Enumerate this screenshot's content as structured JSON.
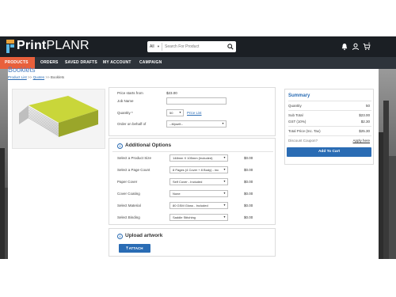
{
  "header": {
    "logo_left": "Print",
    "logo_right": "PLANR",
    "search": {
      "scope": "All",
      "placeholder": "Search For Product"
    },
    "icons": [
      "bell-icon",
      "user-icon",
      "cart-icon"
    ],
    "cart_count": "0"
  },
  "nav": [
    {
      "label": "PRODUCTS",
      "active": true
    },
    {
      "label": "ORDERS",
      "active": false
    },
    {
      "label": "SAVED DRAFTS",
      "active": false
    },
    {
      "label": "MY ACCOUNT",
      "active": false
    },
    {
      "label": "CAMPAIGN",
      "active": false
    }
  ],
  "page": {
    "title": "Booklets",
    "breadcrumb": [
      "Product List",
      "Quotes",
      "Booklets"
    ],
    "breadcrumb_sep": ">>"
  },
  "details": {
    "price_label": "Price starts from",
    "price_value": "$23.00",
    "job_name_label": "Job Name",
    "job_name_value": "",
    "quantity_label": "Quantity *",
    "quantity_value": "50",
    "price_list_link": "Price List",
    "on_behalf_label": "Order on behalf of",
    "on_behalf_value": "--Myself--"
  },
  "options": {
    "title": "Additional Options",
    "rows": [
      {
        "label": "Select a Product Size",
        "value": "148mm X 105mm (Included)",
        "price": "$0.00"
      },
      {
        "label": "Select a Page Count",
        "value": "8 Pages (4 Cover + 8 Body) - inc",
        "price": "$0.00"
      },
      {
        "label": "Paper Cover",
        "value": "Self Cover - Included",
        "price": "$0.00"
      },
      {
        "label": "Cover Coating",
        "value": "None",
        "price": "$0.00"
      },
      {
        "label": "Select Material",
        "value": "80 GSM Gloss - Included",
        "price": "$0.00"
      },
      {
        "label": "Select Binding",
        "value": "Saddle Stitching",
        "price": "$0.00"
      }
    ]
  },
  "upload": {
    "title": "Upload artwork",
    "button": "ATTACH"
  },
  "summary": {
    "title": "Summary",
    "quantity_label": "Quantity",
    "quantity_value": "50",
    "subtotal_label": "Sub Total",
    "subtotal_value": "$23.00",
    "gst_label": "GST (10%)",
    "gst_value": "$2.30",
    "total_label": "Total Price (Inc. Tax)",
    "total_value": "$25.30",
    "coupon_label": "Discount Coupon?",
    "coupon_link": "Apply here",
    "add_to_cart": "Add To Cart"
  },
  "colors": {
    "accent": "#2a6cb4",
    "nav_active": "#e8603c",
    "header_bg": "#1b1f24",
    "nav_bg": "#2e343b"
  }
}
